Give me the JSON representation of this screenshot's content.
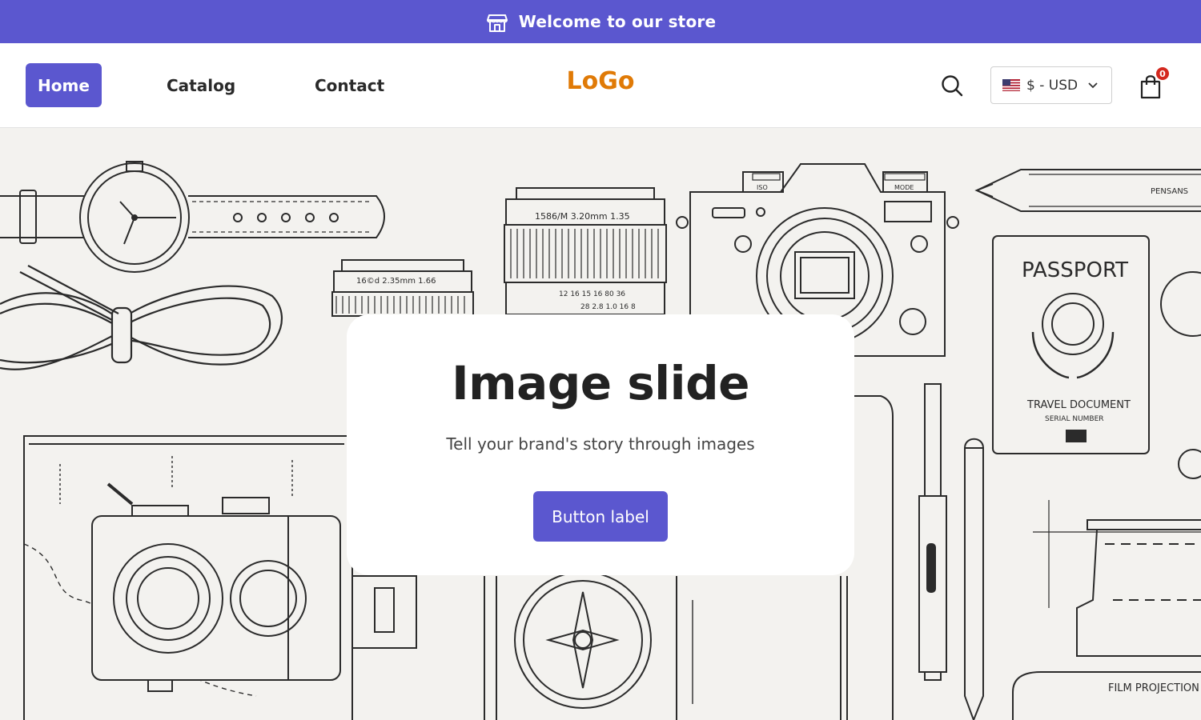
{
  "announcement": {
    "text": "Welcome to our store",
    "icon": "store-icon"
  },
  "nav": {
    "home": "Home",
    "catalog": "Catalog",
    "contact": "Contact"
  },
  "logo": "LoGo",
  "currency": {
    "label": "$ - USD",
    "flag": "us-flag-icon"
  },
  "cart": {
    "count": "0"
  },
  "hero": {
    "title": "Image slide",
    "subtitle": "Tell your brand's story through images",
    "button_label": "Button label",
    "illustration": {
      "lens_small": "16©d  2.35mm  1.66",
      "lens_large": "1586/M  3.20mm  1.35",
      "lens_scale_a": "12  16  15  16  80  36",
      "lens_scale_b": "28  2.8  1.0  16  8",
      "pencil": "PENSANS",
      "passport_title": "PASSPORT",
      "passport_doc": "TRAVEL DOCUMENT",
      "passport_serial": "SERIAL NUMBER",
      "film": "FILM PROJECTION",
      "iso": "ISO",
      "mode": "MODE"
    }
  },
  "colors": {
    "accent": "#5b57cf",
    "logo": "#e07a06",
    "badge": "#d4281e"
  }
}
